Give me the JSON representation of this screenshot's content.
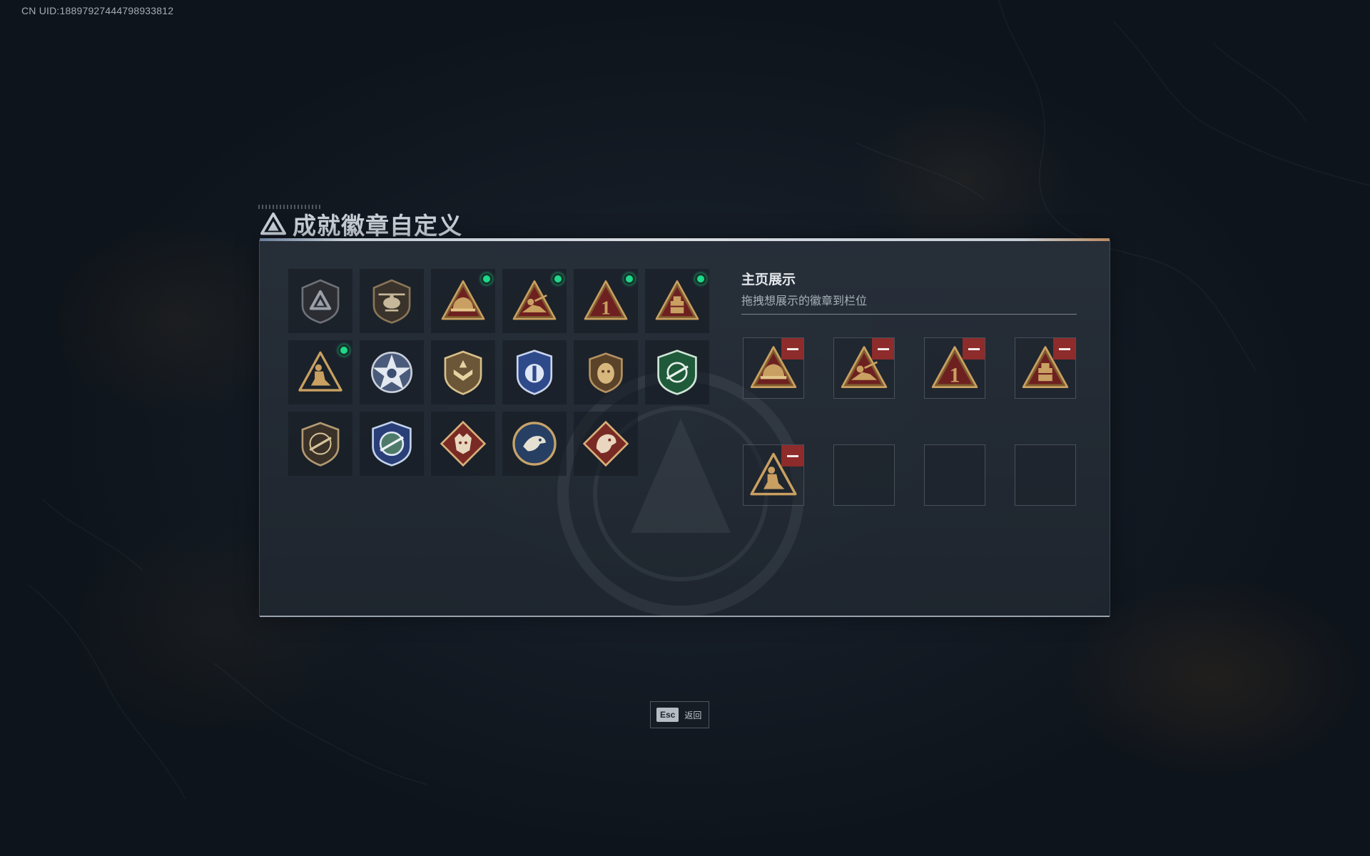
{
  "uid_text": "CN UID:18897927444798933812",
  "title": "成就徽章自定义",
  "showcase": {
    "title": "主页展示",
    "subtitle": "拖拽想展示的徽章到栏位"
  },
  "badges": [
    {
      "icon": "hex-triangle-badge-icon",
      "new": false
    },
    {
      "icon": "helicopter-badge-icon",
      "new": false
    },
    {
      "icon": "helmet-triangle-badge-icon",
      "new": true
    },
    {
      "icon": "soldier-crawl-triangle-badge-icon",
      "new": true
    },
    {
      "icon": "number-one-triangle-badge-icon",
      "new": true
    },
    {
      "icon": "crate-triangle-badge-icon",
      "new": true
    },
    {
      "icon": "kneeling-soldier-triangle-badge-icon",
      "new": true
    },
    {
      "icon": "star-wreath-badge-icon",
      "new": false
    },
    {
      "icon": "chevron-shield-badge-icon",
      "new": false
    },
    {
      "icon": "blue-crest-badge-icon",
      "new": false
    },
    {
      "icon": "lion-shield-badge-icon",
      "new": false
    },
    {
      "icon": "green-crosshair-badge-icon",
      "new": false
    },
    {
      "icon": "rifle-shield-badge-icon",
      "new": false
    },
    {
      "icon": "blue-crosshair-badge-icon",
      "new": false
    },
    {
      "icon": "wolf-diamond-badge-icon",
      "new": false
    },
    {
      "icon": "eagle-roundel-badge-icon",
      "new": false
    },
    {
      "icon": "dragon-diamond-badge-icon",
      "new": false
    }
  ],
  "slots": [
    {
      "icon": "helmet-triangle-badge-icon",
      "filled": true
    },
    {
      "icon": "soldier-crawl-triangle-badge-icon",
      "filled": true
    },
    {
      "icon": "number-one-triangle-badge-icon",
      "filled": true
    },
    {
      "icon": "crate-triangle-badge-icon",
      "filled": true
    },
    {
      "icon": "kneeling-soldier-triangle-badge-icon",
      "filled": true
    },
    {
      "icon": "",
      "filled": false
    },
    {
      "icon": "",
      "filled": false
    },
    {
      "icon": "",
      "filled": false
    }
  ],
  "esc": {
    "key": "Esc",
    "label": "返回"
  },
  "colors": {
    "new_dot": "#1fd88a",
    "remove": "#8e2b2b",
    "gold": "#c9a061",
    "triangle_red": "#7a2424"
  }
}
